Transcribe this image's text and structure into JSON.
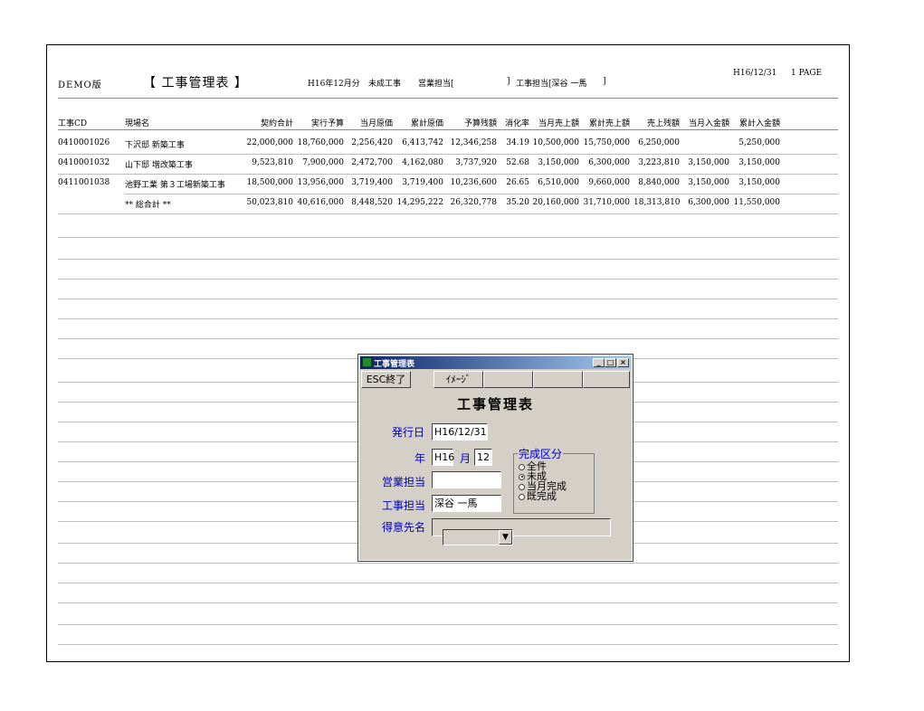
{
  "report": {
    "demo": "DEMO版",
    "title": "【 工事管理表 】",
    "period": "H16年12月分",
    "status": "未成工事",
    "sales_label": "営業担当[",
    "sales_end": "]",
    "engineer": "工事担当[深谷 一馬",
    "engineer_end": "]",
    "date": "H16/12/31",
    "page": "1 PAGE"
  },
  "table": {
    "headers": [
      "工事CD",
      "現場名",
      "契約合計",
      "実行予算",
      "当月原価",
      "累計原価",
      "予算残額",
      "消化率",
      "当月売上額",
      "累計売上額",
      "売上残額",
      "当月入金額",
      "累計入金額"
    ],
    "rows": [
      [
        "0410001026",
        "下沢邸 新築工事",
        "22,000,000",
        "18,760,000",
        "2,256,420",
        "6,413,742",
        "12,346,258",
        "34.19",
        "10,500,000",
        "15,750,000",
        "6,250,000",
        "",
        "5,250,000"
      ],
      [
        "0410001032",
        "山下邸 増改築工事",
        "9,523,810",
        "7,900,000",
        "2,472,700",
        "4,162,080",
        "3,737,920",
        "52.68",
        "3,150,000",
        "6,300,000",
        "3,223,810",
        "3,150,000",
        "3,150,000"
      ],
      [
        "0411001038",
        "池野工業 第３工場新築工事",
        "18,500,000",
        "13,956,000",
        "3,719,400",
        "3,719,400",
        "10,236,600",
        "26.65",
        "6,510,000",
        "9,660,000",
        "8,840,000",
        "3,150,000",
        "3,150,000"
      ]
    ],
    "total": [
      "",
      "** 総合計 **",
      "50,023,810",
      "40,616,000",
      "8,448,520",
      "14,295,222",
      "26,320,778",
      "35.20",
      "20,160,000",
      "31,710,000",
      "18,313,810",
      "6,300,000",
      "11,550,000"
    ]
  },
  "dialog": {
    "title": "工事管理表",
    "minimize": "_",
    "maximize": "□",
    "close": "×",
    "esc_button": "ESC終了",
    "image_button": "ｲﾒｰｼﾞ",
    "heading": "工事管理表",
    "issue_date_label": "発行日",
    "issue_date": "H16/12/31",
    "year_label": "年",
    "year": "H16",
    "month_label": "月",
    "month": "12",
    "sales_label": "営業担当",
    "sales_value": "",
    "engineer_label": "工事担当",
    "engineer_value": "深谷 一馬",
    "customer_label": "得意先名",
    "group_title": "完成区分",
    "options": [
      "全件",
      "未成",
      "当月完成",
      "既完成"
    ],
    "selected_option": "未成",
    "combo_arrow": "▼"
  }
}
